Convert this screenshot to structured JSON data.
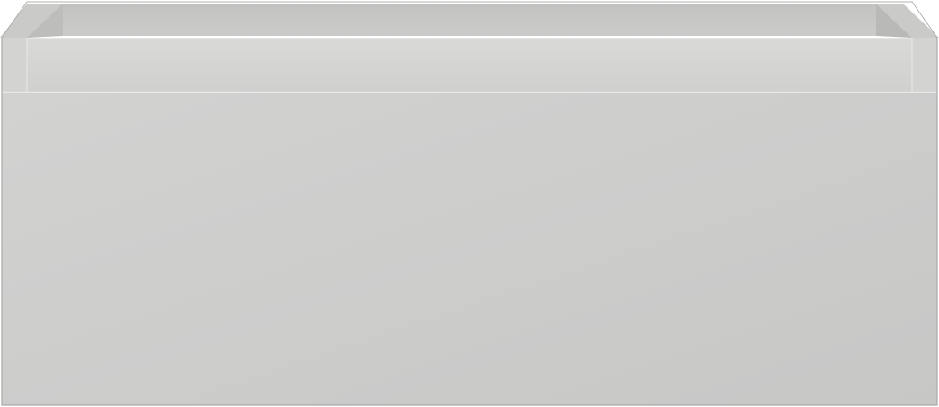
{
  "scene": {
    "subject": "drawer-box",
    "colors": {
      "background": "#ffffff",
      "front_panel_light": "#d0d0cf",
      "front_panel_dark": "#c8c8c7",
      "inner_wall": "#c4c4c3",
      "inner_side_wall": "#b9b9b8",
      "rim": "#d4d4d3",
      "rim_highlight": "#e2e2e1",
      "edge_shadow": "#a8a8a7",
      "corner_post": "#cfcfce"
    }
  }
}
